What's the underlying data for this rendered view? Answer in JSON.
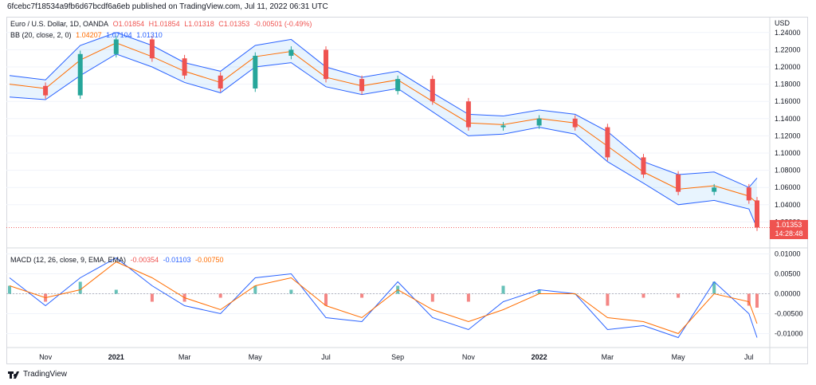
{
  "header": {
    "text": "6fcebc7f18534a9fb6d67bcdf6a6eb published on TradingView.com, Jul 11, 2022 06:31 UTC"
  },
  "legend": {
    "symbol": "Euro / U.S. Dollar, 1D, OANDA",
    "open": "O1.01854",
    "high": "H1.01854",
    "low": "L1.01318",
    "close": "C1.01353",
    "change": "-0.00501 (-0.49%)",
    "bb_label": "BB (20, close, 2, 0)",
    "bb_basis": "1.04207",
    "bb_upper": "1.07104",
    "bb_lower": "1.01310",
    "macd_label": "MACD (12, 26, close, 9, EMA, EMA)",
    "macd_hist": "-0.00354",
    "macd_line": "-0.01103",
    "macd_signal": "-0.00750"
  },
  "price_badge": {
    "price": "1.01353",
    "countdown": "14:28:48"
  },
  "footer": {
    "brand": "TradingView"
  },
  "colors": {
    "up": "#26a69a",
    "down": "#ef5350",
    "bb_band": "#2962ff",
    "bb_basis": "#ff6d00",
    "macd_line": "#2962ff",
    "signal": "#ff6d00"
  },
  "chart_data": [
    {
      "type": "candlestick",
      "title": "Euro / U.S. Dollar, 1D, OANDA",
      "y_axis_label": "USD",
      "y_ticks": [
        "1.24000",
        "1.22000",
        "1.20000",
        "1.18000",
        "1.16000",
        "1.14000",
        "1.12000",
        "1.10000",
        "1.08000",
        "1.06000",
        "1.04000",
        "1.02000"
      ],
      "ylim": [
        1.0,
        1.25
      ],
      "x_ticks": [
        "Nov",
        "2021",
        "Mar",
        "May",
        "Jul",
        "Sep",
        "Nov",
        "2022",
        "Mar",
        "May",
        "Jul"
      ],
      "x": [
        "2020-10-01",
        "2020-11-01",
        "2020-12-01",
        "2021-01-01",
        "2021-02-01",
        "2021-03-01",
        "2021-04-01",
        "2021-05-01",
        "2021-06-01",
        "2021-07-01",
        "2021-08-01",
        "2021-09-01",
        "2021-10-01",
        "2021-11-01",
        "2021-12-01",
        "2022-01-01",
        "2022-02-01",
        "2022-03-01",
        "2022-04-01",
        "2022-05-01",
        "2022-06-01",
        "2022-07-01",
        "2022-07-08"
      ],
      "close": [
        1.178,
        1.167,
        1.215,
        1.232,
        1.21,
        1.19,
        1.175,
        1.213,
        1.22,
        1.186,
        1.172,
        1.186,
        1.16,
        1.13,
        1.132,
        1.14,
        1.13,
        1.095,
        1.075,
        1.055,
        1.06,
        1.045,
        1.0135
      ],
      "bb_upper": [
        1.19,
        1.185,
        1.225,
        1.24,
        1.225,
        1.205,
        1.195,
        1.225,
        1.232,
        1.2,
        1.188,
        1.195,
        1.17,
        1.145,
        1.143,
        1.15,
        1.145,
        1.125,
        1.09,
        1.075,
        1.078,
        1.06,
        1.071
      ],
      "bb_basis": [
        1.18,
        1.175,
        1.208,
        1.228,
        1.212,
        1.195,
        1.182,
        1.212,
        1.218,
        1.188,
        1.178,
        1.185,
        1.16,
        1.135,
        1.133,
        1.14,
        1.135,
        1.108,
        1.078,
        1.058,
        1.062,
        1.05,
        1.042
      ],
      "bb_lower": [
        1.165,
        1.162,
        1.19,
        1.215,
        1.2,
        1.182,
        1.17,
        1.2,
        1.205,
        1.177,
        1.168,
        1.175,
        1.148,
        1.12,
        1.122,
        1.13,
        1.122,
        1.09,
        1.065,
        1.04,
        1.045,
        1.035,
        1.013
      ]
    },
    {
      "type": "line",
      "title": "MACD (12, 26, close, 9, EMA, EMA)",
      "y_ticks": [
        "0.01000",
        "0.00500",
        "0.00000",
        "-0.00500",
        "-0.01000"
      ],
      "ylim": [
        -0.0135,
        0.0105
      ],
      "x": [
        "2020-10-01",
        "2020-11-01",
        "2020-12-01",
        "2021-01-01",
        "2021-02-01",
        "2021-03-01",
        "2021-04-01",
        "2021-05-01",
        "2021-06-01",
        "2021-07-01",
        "2021-08-01",
        "2021-09-01",
        "2021-10-01",
        "2021-11-01",
        "2021-12-01",
        "2022-01-01",
        "2022-02-01",
        "2022-03-01",
        "2022-04-01",
        "2022-05-01",
        "2022-06-01",
        "2022-07-01",
        "2022-07-08"
      ],
      "series": [
        {
          "name": "MACD",
          "values": [
            0.004,
            -0.003,
            0.004,
            0.009,
            0.002,
            -0.003,
            -0.005,
            0.004,
            0.005,
            -0.006,
            -0.007,
            0.003,
            -0.006,
            -0.009,
            -0.002,
            0.001,
            0.0,
            -0.009,
            -0.008,
            -0.011,
            0.003,
            -0.005,
            -0.011
          ]
        },
        {
          "name": "Signal",
          "values": [
            0.002,
            -0.001,
            0.001,
            0.008,
            0.004,
            -0.001,
            -0.004,
            0.002,
            0.004,
            -0.003,
            -0.006,
            0.001,
            -0.004,
            -0.007,
            -0.004,
            0.0,
            0.0,
            -0.006,
            -0.007,
            -0.01,
            0.0,
            -0.002,
            -0.0075
          ]
        },
        {
          "name": "Histogram",
          "values": [
            0.002,
            -0.002,
            0.003,
            0.001,
            -0.002,
            -0.002,
            -0.001,
            0.002,
            0.001,
            -0.003,
            -0.001,
            0.002,
            -0.002,
            -0.002,
            0.002,
            0.001,
            0.0,
            -0.003,
            -0.001,
            -0.001,
            0.003,
            -0.003,
            -0.0035
          ]
        }
      ]
    }
  ]
}
